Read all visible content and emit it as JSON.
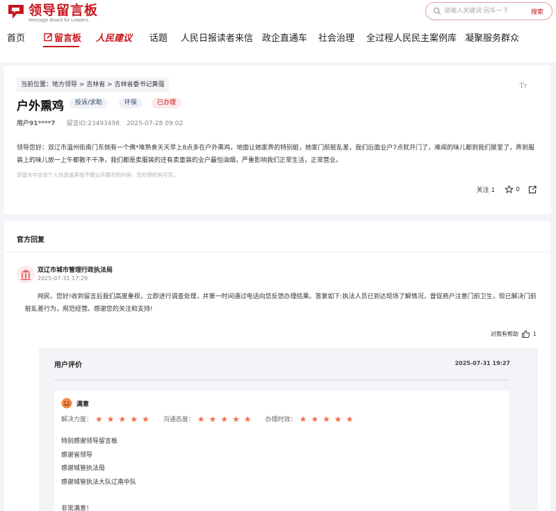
{
  "header": {
    "logo_title": "领导留言板",
    "logo_subtitle": "Message Board for Leaders",
    "search_placeholder": "请输入关键词 回车一下",
    "search_button": "搜索"
  },
  "nav": {
    "items": [
      "首页",
      "留言板",
      "人民建议",
      "话题",
      "人民日报读者来信",
      "政企直通车",
      "社会治理",
      "全过程人民民主案例库",
      "凝聚服务群众"
    ],
    "active_index": 1
  },
  "message": {
    "breadcrumb": "当前位置：地方领导 > 吉林省 > 吉林省委书记黄强",
    "font_size_icon": "Tт",
    "title": "户外熏鸡",
    "tags": [
      "投诉/求助",
      "环保",
      "已办理"
    ],
    "user": "用户91****7",
    "message_id": "留言ID:23493498",
    "date": "2025-07-28 09:02",
    "content": "领导您好：双辽市温州街南门东侧有一个佛*堆熟食天天早上8点多在户外熏鸡，地面让她家弄的特别脏，她家门前脏乱差，我们后面业户7点就开门了，难闻的味儿都到我们屋里了，弄到服装上的味儿放一上午都散不干净，我们都是卖服装的还有卖童装的业户最怕油烟，严重影响我们正常生活，正常营业。",
    "notice": "该留言中含有个人信息或其他不便公开展示的内容，仅办理机构可见。",
    "follow_label": "关注",
    "follow_count": "1",
    "star_count": "0"
  },
  "reply": {
    "section_title": "官方回复",
    "org_name": "双辽市城市管理行政执法局",
    "reply_time": "2025-07-31 17:29",
    "content": "网民，您好!收到留言后我们高度重视，立即进行调查处理，并第一时间通过电话向您反馈办理结果。答复如下:执法人员已到达现场了解情况，督促商户注意门前卫生，现已解决门前脏乱差行为，规范经营。感谢您的关注和支持!",
    "helpful_label": "对我有帮助",
    "helpful_count": "1"
  },
  "evaluation": {
    "title": "用户评价",
    "time": "2025-07-31 19:27",
    "overall": "满意",
    "ratings": [
      {
        "label": "解决力度：",
        "stars": 5
      },
      {
        "label": "沟通态度：",
        "stars": 5
      },
      {
        "label": "办理时效：",
        "stars": 5
      }
    ],
    "comment_lines": [
      "特别感谢领导留言板",
      "感谢省领导",
      "感谢城管执法局",
      "感谢城管执法大队辽南中队",
      "",
      "非常满意！"
    ]
  },
  "colors": {
    "brand_red": "#c8161d",
    "star_orange": "#f26a4b"
  },
  "icons": [
    "logo-icon",
    "search-icon",
    "pen-icon",
    "star-icon",
    "share-icon",
    "building-icon",
    "thumbs-up-icon",
    "smiley-face-icon"
  ]
}
